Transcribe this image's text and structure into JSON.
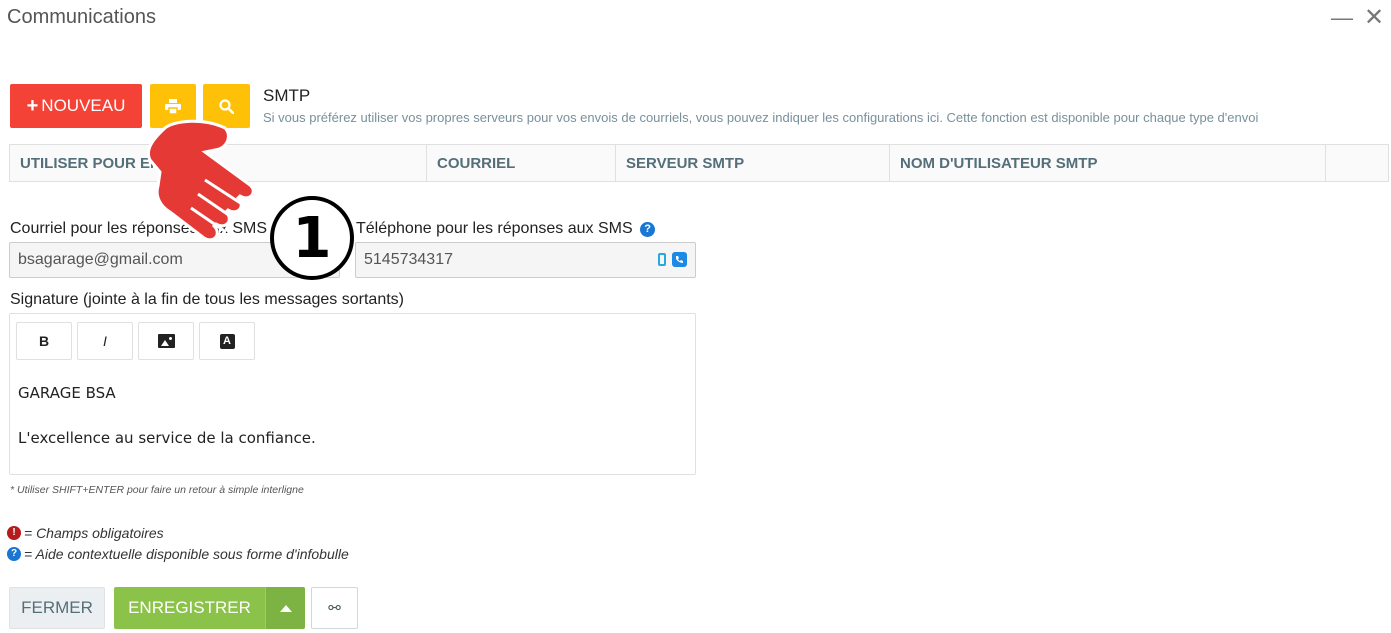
{
  "window": {
    "title": "Communications",
    "minimize_glyph": "—",
    "close_glyph": "✕"
  },
  "toolbar": {
    "new_plus": "+",
    "new_label": "NOUVEAU",
    "print_icon": "print-icon",
    "search_icon": "search-icon"
  },
  "smtp": {
    "title": "SMTP",
    "description": "Si vous préférez utiliser vos propres serveurs pour vos envois de courriels, vous pouvez indiquer les configurations ici. Cette fonction est disponible pour chaque type d'envoi"
  },
  "table": {
    "columns": [
      "UTILISER POUR ENVOYER",
      "COURRIEL",
      "SERVEUR SMTP",
      "NOM D'UTILISATEUR SMTP",
      ""
    ]
  },
  "form": {
    "email_label": "Courriel pour les réponses aux SMS",
    "email_value": "bsagarage@gmail.com",
    "phone_label": "Téléphone pour les réponses aux SMS",
    "phone_value": "5145734317",
    "help_glyph": "?",
    "signature_label": "Signature (jointe à la fin de tous les messages sortants)",
    "editor": {
      "bold": "B",
      "italic": "I",
      "font_glyph": "A",
      "lines": [
        "GARAGE BSA",
        "L'excellence au service de la confiance."
      ]
    },
    "hint": "* Utiliser SHIFT+ENTER pour faire un retour à simple interligne"
  },
  "legend": {
    "required_glyph": "!",
    "required": "= Champs obligatoires",
    "help_glyph": "?",
    "help": "= Aide contextuelle disponible sous forme d'infobulle"
  },
  "footer": {
    "close_label": "FERMER",
    "save_label": "ENREGISTRER",
    "link_glyph": "⚯"
  },
  "annotation": {
    "step_number": "1",
    "arrow_color": "#e53935"
  },
  "colors": {
    "new_button": "#f44336",
    "tool_buttons": "#ffc107",
    "save_button": "#8bc34a",
    "table_header_text": "#546e7a"
  }
}
